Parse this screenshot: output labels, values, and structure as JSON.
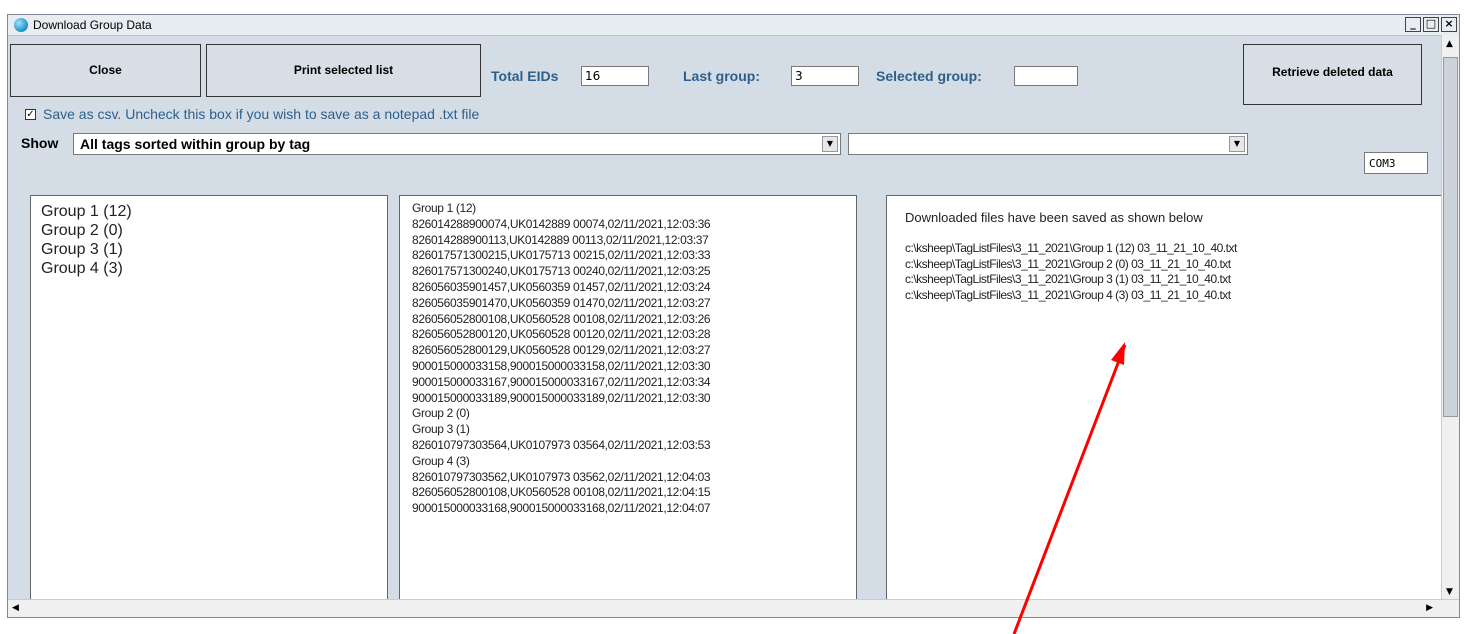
{
  "window": {
    "title": "Download Group Data"
  },
  "titlebar": {
    "minimize": "_",
    "maximize": "□",
    "close": "×"
  },
  "toolbar": {
    "close_label": "Close",
    "print_label": "Print selected list",
    "retrieve_label": "Retrieve deleted data",
    "total_eids_label": "Total EIDs",
    "total_eids_value": "16",
    "last_group_label": "Last group:",
    "last_group_value": "3",
    "selected_group_label": "Selected group:",
    "selected_group_value": ""
  },
  "save": {
    "checkbox_mark": "✓",
    "text": "Save as csv.  Uncheck this box if you wish to save as a notepad .txt file",
    "checked": true
  },
  "show": {
    "label": "Show",
    "selected": "All tags sorted within group by tag",
    "second_selected": "",
    "port": "COM3"
  },
  "groups": [
    "Group 1 (12)",
    "Group 2 (0)",
    "Group 3 (1)",
    "Group 4 (3)"
  ],
  "tag_lines": [
    "Group 1 (12)",
    "826014288900074,UK0142889 00074,02/11/2021,12:03:36",
    "826014288900113,UK0142889 00113,02/11/2021,12:03:37",
    "826017571300215,UK0175713 00215,02/11/2021,12:03:33",
    "826017571300240,UK0175713 00240,02/11/2021,12:03:25",
    "826056035901457,UK0560359 01457,02/11/2021,12:03:24",
    "826056035901470,UK0560359 01470,02/11/2021,12:03:27",
    "826056052800108,UK0560528 00108,02/11/2021,12:03:26",
    "826056052800120,UK0560528 00120,02/11/2021,12:03:28",
    "826056052800129,UK0560528 00129,02/11/2021,12:03:27",
    "900015000033158,900015000033158,02/11/2021,12:03:30",
    "900015000033167,900015000033167,02/11/2021,12:03:34",
    "900015000033189,900015000033189,02/11/2021,12:03:30",
    "Group 2 (0)",
    "Group 3 (1)",
    "826010797303564,UK0107973 03564,02/11/2021,12:03:53",
    "Group 4 (3)",
    "826010797303562,UK0107973 03562,02/11/2021,12:04:03",
    "826056052800108,UK0560528 00108,02/11/2021,12:04:15",
    "900015000033168,900015000033168,02/11/2021,12:04:07"
  ],
  "files": {
    "header": "Downloaded files have been saved as shown below",
    "paths": [
      "c:\\ksheep\\TagListFiles\\3_11_2021\\Group 1 (12) 03_11_21_10_40.txt",
      "c:\\ksheep\\TagListFiles\\3_11_2021\\Group 2 (0) 03_11_21_10_40.txt",
      "c:\\ksheep\\TagListFiles\\3_11_2021\\Group 3 (1) 03_11_21_10_40.txt",
      "c:\\ksheep\\TagListFiles\\3_11_2021\\Group 4 (3) 03_11_21_10_40.txt"
    ]
  },
  "scroll": {
    "up": "▲",
    "down": "▼",
    "left": "◀",
    "right": "▶"
  },
  "dropdown_arrow": "▼",
  "annotation": {
    "color": "#ff0000"
  }
}
